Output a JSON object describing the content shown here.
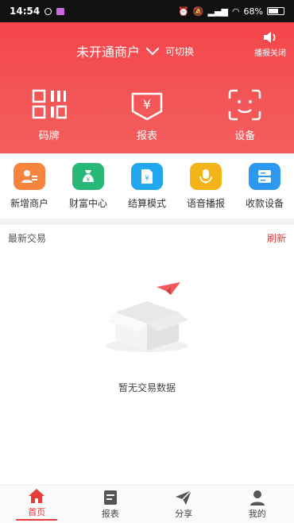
{
  "status_bar": {
    "time": "14:54",
    "battery": "68%",
    "battery_level": 0.68
  },
  "header": {
    "merchant_name": "未开通商户",
    "switch_label": "可切换",
    "broadcast_label": "播报关闭"
  },
  "big_items": [
    {
      "label": "码牌",
      "icon": "qr-code-icon"
    },
    {
      "label": "报表",
      "icon": "yen-report-icon"
    },
    {
      "label": "设备",
      "icon": "scan-face-icon"
    }
  ],
  "quick_items": [
    {
      "label": "新增商户",
      "icon": "add-merchant-icon",
      "color": "#f7843c"
    },
    {
      "label": "财富中心",
      "icon": "money-bag-icon",
      "color": "#28b877"
    },
    {
      "label": "结算模式",
      "icon": "document-yen-icon",
      "color": "#23a7ee"
    },
    {
      "label": "语音播报",
      "icon": "microphone-icon",
      "color": "#f3b419"
    },
    {
      "label": "收款设备",
      "icon": "server-icon",
      "color": "#2c98ef"
    }
  ],
  "transactions": {
    "title": "最新交易",
    "refresh_label": "刷新",
    "empty_text": "暂无交易数据"
  },
  "nav": [
    {
      "label": "首页",
      "icon": "home-icon"
    },
    {
      "label": "报表",
      "icon": "report-icon"
    },
    {
      "label": "分享",
      "icon": "send-icon"
    },
    {
      "label": "我的",
      "icon": "user-icon"
    }
  ],
  "colors": {
    "accent": "#e63b3b",
    "header_red": "#f4454a"
  }
}
